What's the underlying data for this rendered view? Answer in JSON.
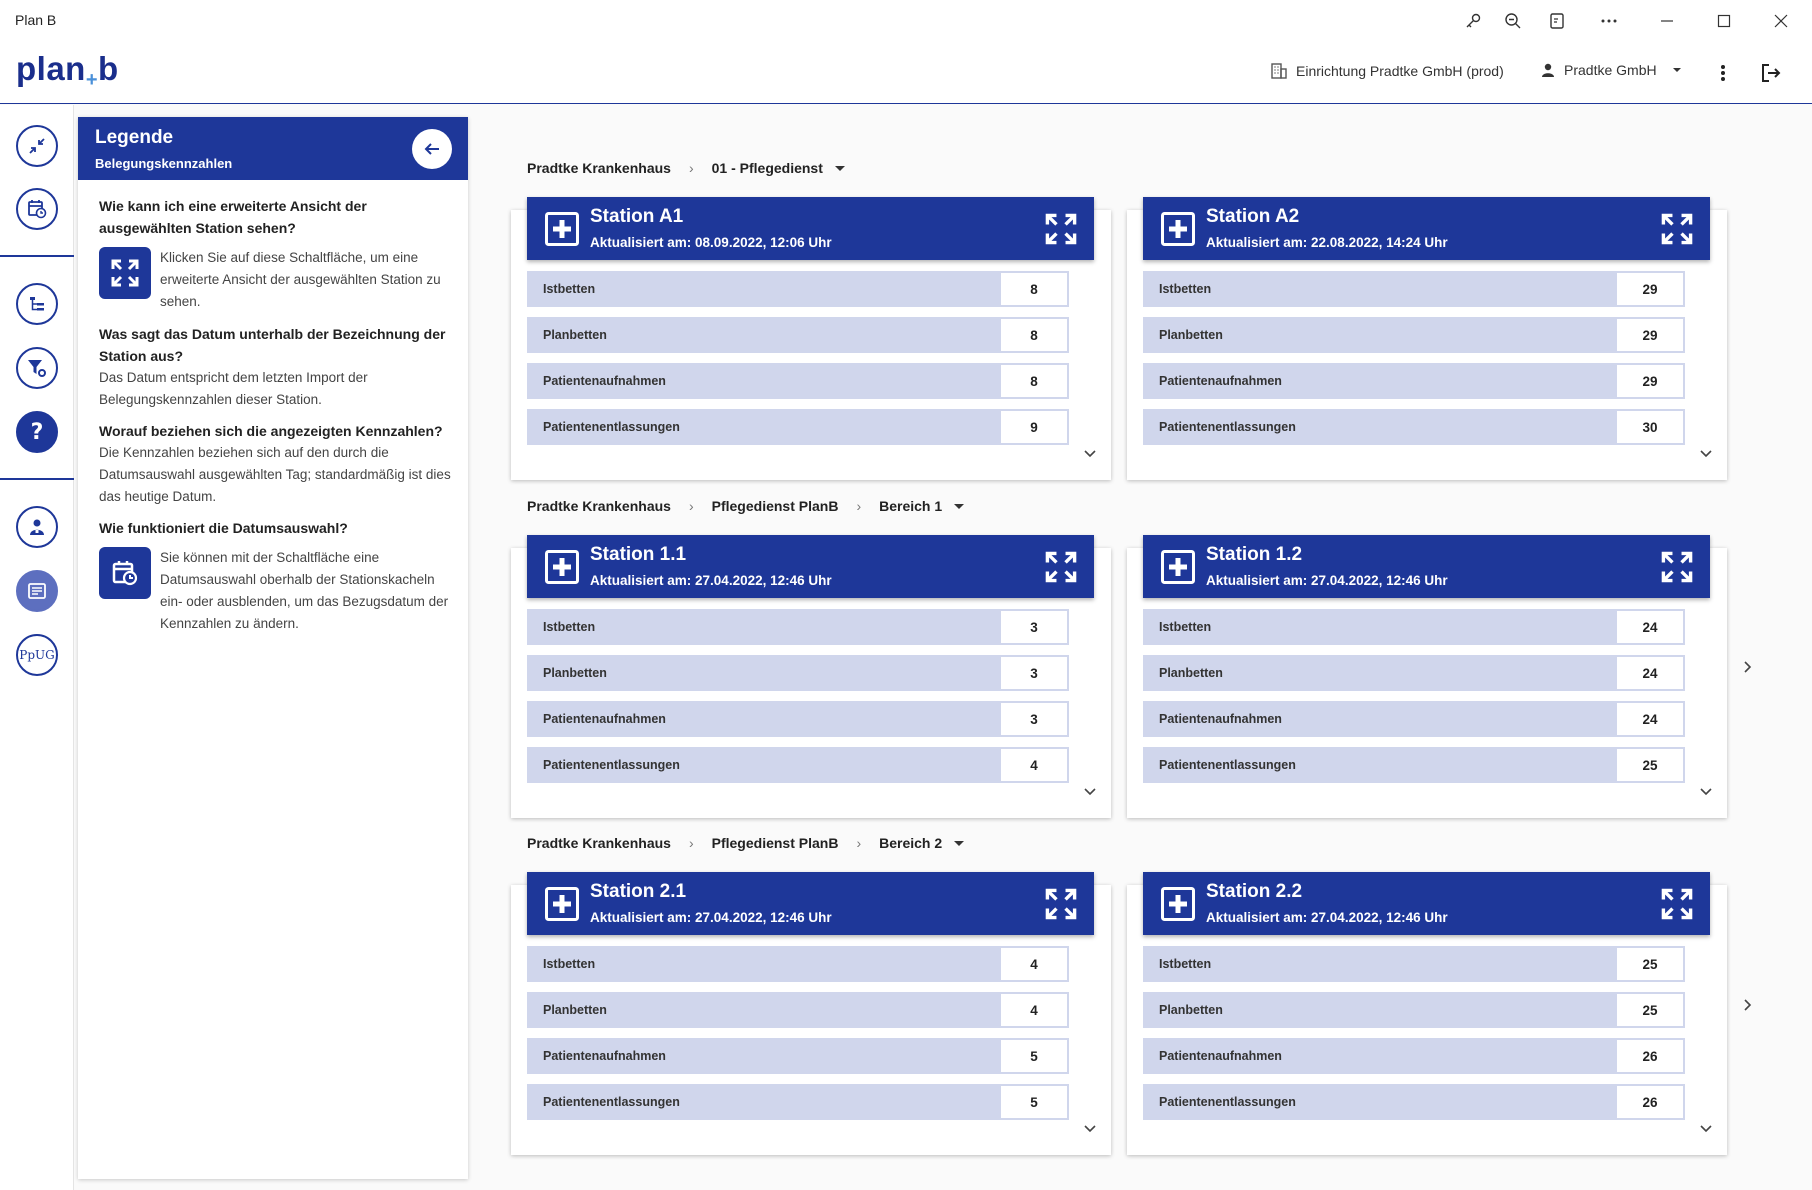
{
  "window": {
    "title": "Plan B"
  },
  "header": {
    "logo_left": "plan",
    "logo_plus": "+",
    "logo_right": "b",
    "facility": "Einrichtung Pradtke GmbH (prod)",
    "user": "Pradtke GmbH"
  },
  "rail": {
    "ppug_label": "PpUG"
  },
  "legend": {
    "title": "Legende",
    "subtitle": "Belegungskennzahlen",
    "q1": "Wie kann ich eine erweiterte Ansicht der ausgewählten Station sehen?",
    "a1": "Klicken Sie auf diese Schaltfläche, um eine erweiterte Ansicht der ausgewählten Station zu sehen.",
    "q2": "Was sagt das Datum unterhalb der Bezeichnung der Station aus?",
    "a2": "Das Datum entspricht dem letzten Import der Belegungskennzahlen dieser Station.",
    "q3": "Worauf beziehen sich die angezeigten Kennzahlen?",
    "a3": "Die Kennzahlen beziehen sich auf den durch die Datumsauswahl ausgewählten Tag; standardmäßig ist dies das heutige Datum.",
    "q4": "Wie funktioniert die Datumsauswahl?",
    "a4": "Sie können mit der Schaltfläche eine Datumsauswahl oberhalb der Stationskacheln ein- oder ausblenden, um das Bezugsdatum der Kennzahlen zu ändern."
  },
  "groups": [
    {
      "crumbs": [
        "Pradtke Krankenhaus",
        "01 - Pflegedienst"
      ],
      "stations": [
        {
          "name": "Station A1",
          "updated": "Aktualisiert am: 08.09.2022, 12:06 Uhr",
          "values": [
            "8",
            "8",
            "8",
            "9"
          ]
        },
        {
          "name": "Station A2",
          "updated": "Aktualisiert am: 22.08.2022, 14:24 Uhr",
          "values": [
            "29",
            "29",
            "29",
            "30"
          ]
        }
      ]
    },
    {
      "crumbs": [
        "Pradtke Krankenhaus",
        "Pflegedienst PlanB",
        "Bereich 1"
      ],
      "stations": [
        {
          "name": "Station 1.1",
          "updated": "Aktualisiert am: 27.04.2022, 12:46 Uhr",
          "values": [
            "3",
            "3",
            "3",
            "4"
          ]
        },
        {
          "name": "Station 1.2",
          "updated": "Aktualisiert am: 27.04.2022, 12:46 Uhr",
          "values": [
            "24",
            "24",
            "24",
            "25"
          ]
        }
      ]
    },
    {
      "crumbs": [
        "Pradtke Krankenhaus",
        "Pflegedienst PlanB",
        "Bereich 2"
      ],
      "stations": [
        {
          "name": "Station 2.1",
          "updated": "Aktualisiert am: 27.04.2022, 12:46 Uhr",
          "values": [
            "4",
            "4",
            "5",
            "5"
          ]
        },
        {
          "name": "Station 2.2",
          "updated": "Aktualisiert am: 27.04.2022, 12:46 Uhr",
          "values": [
            "25",
            "25",
            "26",
            "26"
          ]
        }
      ]
    }
  ],
  "row_labels": [
    "Istbetten",
    "Planbetten",
    "Patientenaufnahmen",
    "Patientenentlassungen"
  ],
  "colors": {
    "primary": "#1e3799",
    "row_bg": "#d0d6ec",
    "accent": "#4a90d9"
  }
}
